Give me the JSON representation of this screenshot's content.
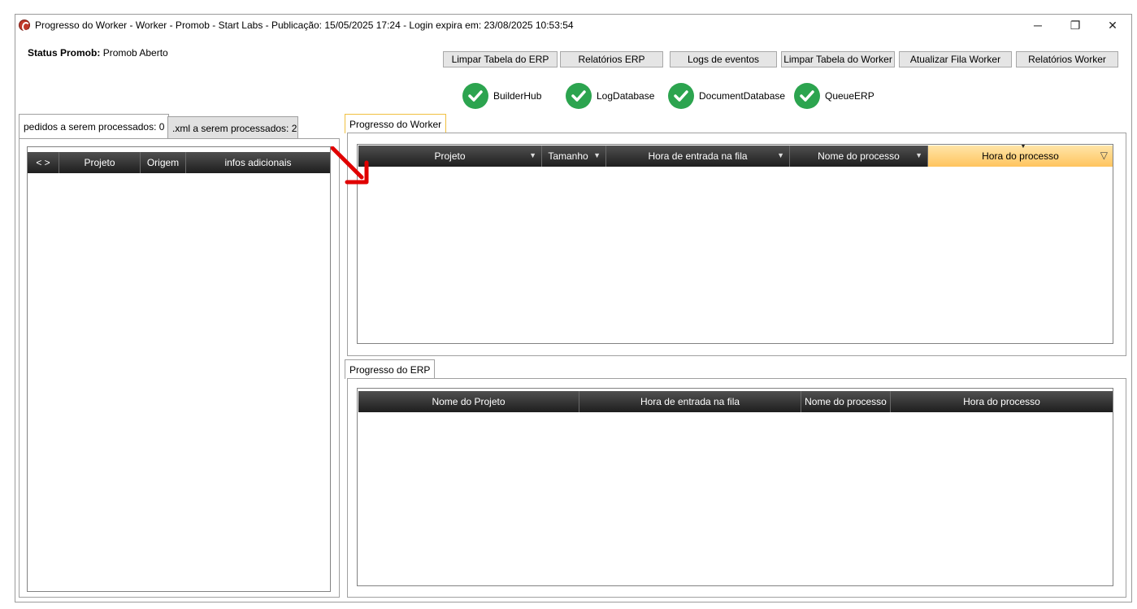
{
  "window": {
    "title": "Progresso do Worker  -  Worker  - Promob -  Start Labs  -  Publicação: 15/05/2025 17:24 - Login expira em: 23/08/2025 10:53:54",
    "controls": {
      "minimize": "─",
      "restore": "❐",
      "close": "✕"
    }
  },
  "status": {
    "label": "Status Promob:",
    "value": "Promob Aberto"
  },
  "toolbar": {
    "limpar_erp": "Limpar Tabela do ERP",
    "relatorios_erp": "Relatórios ERP",
    "logs": "Logs de eventos",
    "limpar_worker": "Limpar Tabela do Worker",
    "atualizar_fila": "Atualizar Fila Worker",
    "relatorios_worker": "Relatórios Worker"
  },
  "services": [
    "BuilderHub",
    "LogDatabase",
    "DocumentDatabase",
    "QueueERP"
  ],
  "left_tabs": {
    "pedidos": "pedidos a serem processados: 0",
    "xml": ".xml a serem processados: 2"
  },
  "left_grid": {
    "columns": [
      "< >",
      "Projeto",
      "Origem",
      "infos adicionais"
    ]
  },
  "worker_panel": {
    "tab": "Progresso do Worker",
    "columns": [
      "Projeto",
      "Tamanho",
      "Hora de entrada na fila",
      "Nome do processo",
      "Hora do processo"
    ]
  },
  "erp_panel": {
    "tab": "Progresso do ERP",
    "columns": [
      "Nome do Projeto",
      "Hora de entrada na fila",
      "Nome do processo",
      "Hora do processo"
    ]
  },
  "colors": {
    "check_green": "#2ca44f",
    "header_dark": "#1e1e1e",
    "highlight": "#ffc45e",
    "arrow_red": "#e00000"
  }
}
